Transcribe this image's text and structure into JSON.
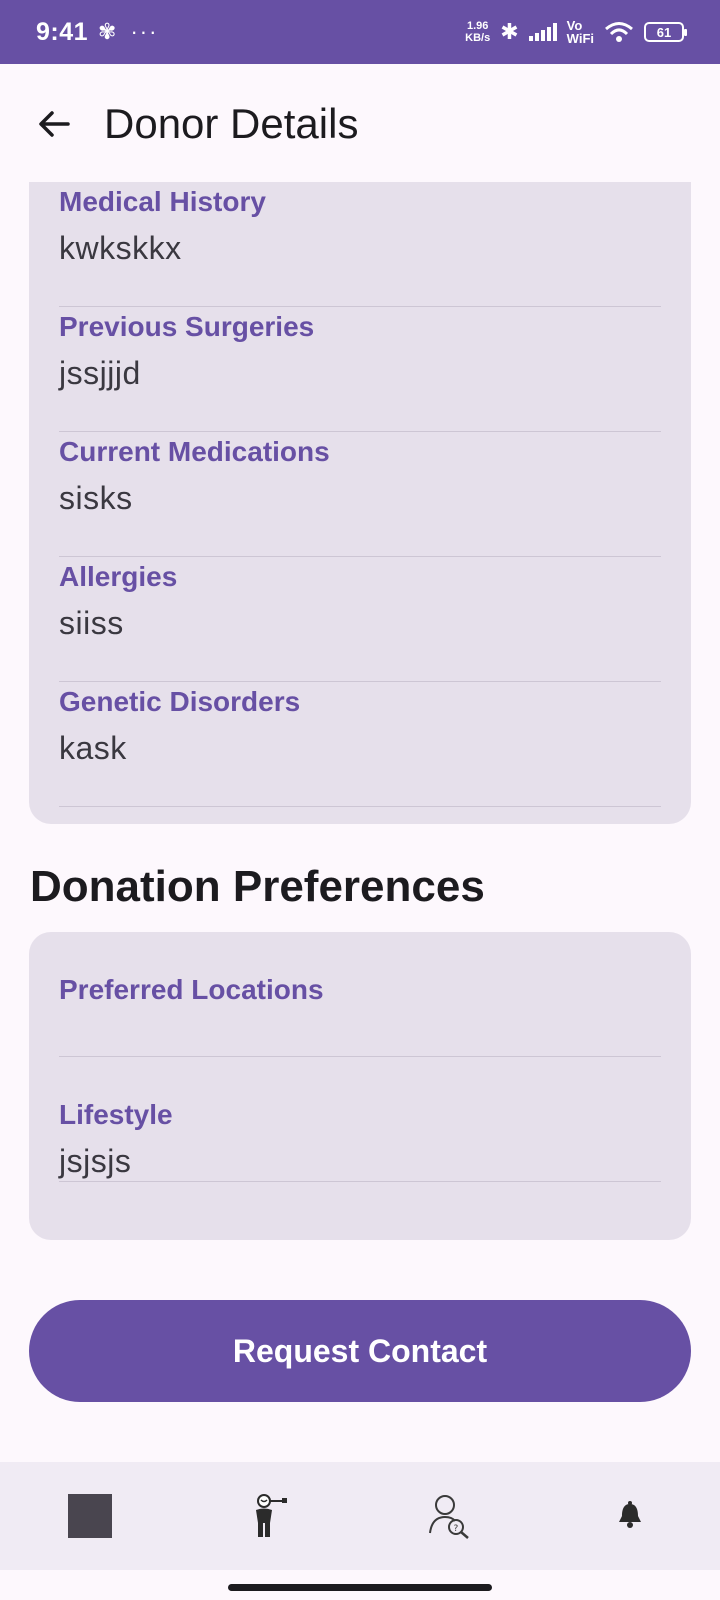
{
  "status_bar": {
    "time": "9:41",
    "speed_value": "1.96",
    "speed_unit": "KB/s",
    "vo": "Vo",
    "wifi": "WiFi",
    "battery": "61"
  },
  "app_bar": {
    "title": "Donor Details"
  },
  "medical": {
    "fields": [
      {
        "label": "Medical History",
        "value": "kwkskkx"
      },
      {
        "label": "Previous Surgeries",
        "value": "jssjjjd"
      },
      {
        "label": "Current Medications",
        "value": "sisks"
      },
      {
        "label": "Allergies",
        "value": "siiss"
      },
      {
        "label": "Genetic Disorders",
        "value": "kask"
      }
    ]
  },
  "preferences": {
    "title": "Donation Preferences",
    "fields": [
      {
        "label": "Preferred Locations",
        "value": ""
      },
      {
        "label": "Lifestyle",
        "value": "jsjsjs"
      }
    ]
  },
  "actions": {
    "request_contact": "Request Contact"
  },
  "bottom_nav": {
    "items": [
      "home-icon",
      "donor-icon",
      "search-user-icon",
      "notification-icon"
    ]
  },
  "colors": {
    "primary": "#6750a4",
    "card": "#e6e0eb",
    "background": "#fdf8fd"
  }
}
